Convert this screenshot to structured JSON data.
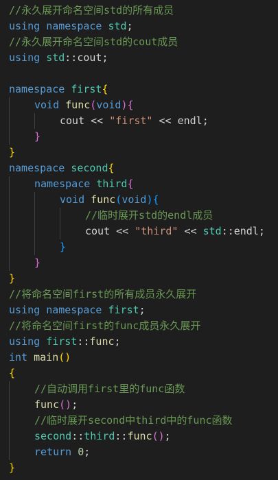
{
  "colors": {
    "background": "#1e1e1e",
    "comment": "#6a9955",
    "keyword": "#569cd6",
    "type": "#4ec9b0",
    "function": "#dcdcaa",
    "string": "#ce9178",
    "number": "#b5cea8",
    "default": "#d4d4d4",
    "brace1": "#ffd700",
    "brace2": "#da70d6",
    "brace3": "#179fff",
    "guide": "#404040"
  },
  "lines": [
    {
      "indent": 0,
      "tokens": [
        {
          "t": "//永久展开命名空间std的所有成员",
          "c": "comment"
        }
      ]
    },
    {
      "indent": 0,
      "tokens": [
        {
          "t": "using",
          "c": "keyword"
        },
        {
          "t": " ",
          "c": "default"
        },
        {
          "t": "namespace",
          "c": "keyword"
        },
        {
          "t": " ",
          "c": "default"
        },
        {
          "t": "std",
          "c": "type"
        },
        {
          "t": ";",
          "c": "default"
        }
      ]
    },
    {
      "indent": 0,
      "tokens": [
        {
          "t": "//永久展开命名空间std的cout成员",
          "c": "comment"
        }
      ]
    },
    {
      "indent": 0,
      "tokens": [
        {
          "t": "using",
          "c": "keyword"
        },
        {
          "t": " ",
          "c": "default"
        },
        {
          "t": "std",
          "c": "type"
        },
        {
          "t": "::",
          "c": "default"
        },
        {
          "t": "cout",
          "c": "default"
        },
        {
          "t": ";",
          "c": "default"
        }
      ]
    },
    {
      "indent": 0,
      "tokens": []
    },
    {
      "indent": 0,
      "tokens": [
        {
          "t": "namespace",
          "c": "keyword"
        },
        {
          "t": " ",
          "c": "default"
        },
        {
          "t": "first",
          "c": "type"
        },
        {
          "t": "{",
          "c": "brace1"
        }
      ]
    },
    {
      "indent": 1,
      "tokens": [
        {
          "t": "void",
          "c": "keyword"
        },
        {
          "t": " ",
          "c": "default"
        },
        {
          "t": "func",
          "c": "function"
        },
        {
          "t": "(",
          "c": "brace2"
        },
        {
          "t": "void",
          "c": "keyword"
        },
        {
          "t": ")",
          "c": "brace2"
        },
        {
          "t": "{",
          "c": "brace2"
        }
      ]
    },
    {
      "indent": 2,
      "tokens": [
        {
          "t": "cout",
          "c": "default"
        },
        {
          "t": " << ",
          "c": "default"
        },
        {
          "t": "\"first\"",
          "c": "string"
        },
        {
          "t": " << ",
          "c": "default"
        },
        {
          "t": "endl",
          "c": "default"
        },
        {
          "t": ";",
          "c": "default"
        }
      ]
    },
    {
      "indent": 1,
      "tokens": [
        {
          "t": "}",
          "c": "brace2"
        }
      ]
    },
    {
      "indent": 0,
      "tokens": [
        {
          "t": "}",
          "c": "brace1"
        }
      ]
    },
    {
      "indent": 0,
      "tokens": [
        {
          "t": "namespace",
          "c": "keyword"
        },
        {
          "t": " ",
          "c": "default"
        },
        {
          "t": "second",
          "c": "type"
        },
        {
          "t": "{",
          "c": "brace1"
        }
      ]
    },
    {
      "indent": 1,
      "tokens": [
        {
          "t": "namespace",
          "c": "keyword"
        },
        {
          "t": " ",
          "c": "default"
        },
        {
          "t": "third",
          "c": "type"
        },
        {
          "t": "{",
          "c": "brace2"
        }
      ]
    },
    {
      "indent": 2,
      "tokens": [
        {
          "t": "void",
          "c": "keyword"
        },
        {
          "t": " ",
          "c": "default"
        },
        {
          "t": "func",
          "c": "function"
        },
        {
          "t": "(",
          "c": "brace3"
        },
        {
          "t": "void",
          "c": "keyword"
        },
        {
          "t": ")",
          "c": "brace3"
        },
        {
          "t": "{",
          "c": "brace3"
        }
      ]
    },
    {
      "indent": 3,
      "tokens": [
        {
          "t": "//临时展开std的endl成员",
          "c": "comment"
        }
      ]
    },
    {
      "indent": 3,
      "tokens": [
        {
          "t": "cout",
          "c": "default"
        },
        {
          "t": " << ",
          "c": "default"
        },
        {
          "t": "\"third\"",
          "c": "string"
        },
        {
          "t": " << ",
          "c": "default"
        },
        {
          "t": "std",
          "c": "type"
        },
        {
          "t": "::",
          "c": "default"
        },
        {
          "t": "endl",
          "c": "default"
        },
        {
          "t": ";",
          "c": "default"
        }
      ]
    },
    {
      "indent": 2,
      "tokens": [
        {
          "t": "}",
          "c": "brace3"
        }
      ]
    },
    {
      "indent": 1,
      "tokens": [
        {
          "t": "}",
          "c": "brace2"
        }
      ]
    },
    {
      "indent": 0,
      "tokens": [
        {
          "t": "}",
          "c": "brace1"
        }
      ]
    },
    {
      "indent": 0,
      "tokens": [
        {
          "t": "//将命名空间first的所有成员永久展开",
          "c": "comment"
        }
      ]
    },
    {
      "indent": 0,
      "tokens": [
        {
          "t": "using",
          "c": "keyword"
        },
        {
          "t": " ",
          "c": "default"
        },
        {
          "t": "namespace",
          "c": "keyword"
        },
        {
          "t": " ",
          "c": "default"
        },
        {
          "t": "first",
          "c": "type"
        },
        {
          "t": ";",
          "c": "default"
        }
      ]
    },
    {
      "indent": 0,
      "tokens": [
        {
          "t": "//将命名空间first的func成员永久展开",
          "c": "comment"
        }
      ]
    },
    {
      "indent": 0,
      "tokens": [
        {
          "t": "using",
          "c": "keyword"
        },
        {
          "t": " ",
          "c": "default"
        },
        {
          "t": "first",
          "c": "type"
        },
        {
          "t": "::",
          "c": "default"
        },
        {
          "t": "func",
          "c": "function"
        },
        {
          "t": ";",
          "c": "default"
        }
      ]
    },
    {
      "indent": 0,
      "tokens": [
        {
          "t": "int",
          "c": "keyword"
        },
        {
          "t": " ",
          "c": "default"
        },
        {
          "t": "main",
          "c": "function"
        },
        {
          "t": "()",
          "c": "brace1"
        }
      ]
    },
    {
      "indent": 0,
      "tokens": [
        {
          "t": "{",
          "c": "brace1"
        }
      ]
    },
    {
      "indent": 1,
      "tokens": [
        {
          "t": "//自动调用first里的func函数",
          "c": "comment"
        }
      ]
    },
    {
      "indent": 1,
      "tokens": [
        {
          "t": "func",
          "c": "function"
        },
        {
          "t": "()",
          "c": "brace2"
        },
        {
          "t": ";",
          "c": "default"
        }
      ]
    },
    {
      "indent": 1,
      "tokens": [
        {
          "t": "//临时展开second中third中的func函数",
          "c": "comment"
        }
      ]
    },
    {
      "indent": 1,
      "tokens": [
        {
          "t": "second",
          "c": "type"
        },
        {
          "t": "::",
          "c": "default"
        },
        {
          "t": "third",
          "c": "type"
        },
        {
          "t": "::",
          "c": "default"
        },
        {
          "t": "func",
          "c": "function"
        },
        {
          "t": "()",
          "c": "brace2"
        },
        {
          "t": ";",
          "c": "default"
        }
      ]
    },
    {
      "indent": 1,
      "tokens": [
        {
          "t": "return",
          "c": "keyword"
        },
        {
          "t": " ",
          "c": "default"
        },
        {
          "t": "0",
          "c": "number"
        },
        {
          "t": ";",
          "c": "default"
        }
      ]
    },
    {
      "indent": 0,
      "tokens": [
        {
          "t": "}",
          "c": "brace1"
        }
      ]
    }
  ]
}
